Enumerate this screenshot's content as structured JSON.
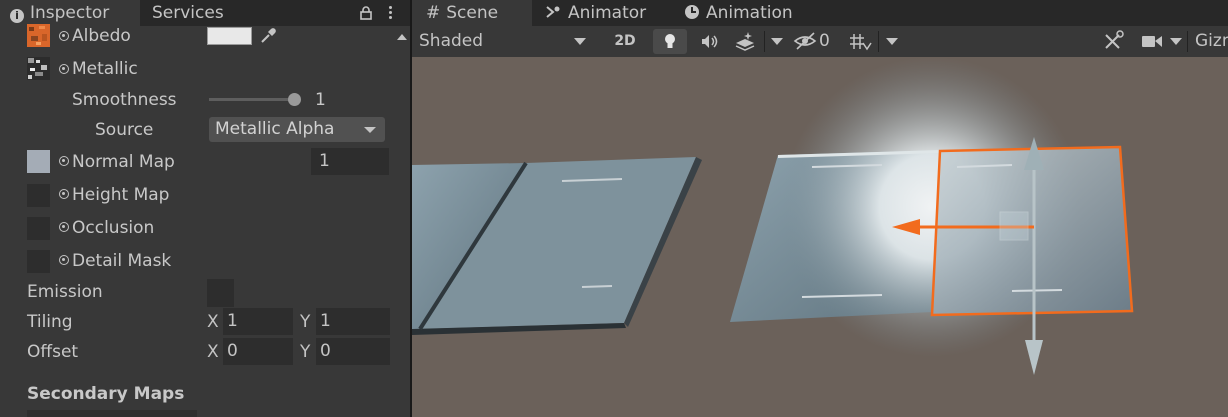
{
  "inspector": {
    "tabs": {
      "inspector": "Inspector",
      "services": "Services"
    },
    "properties": {
      "albedo": "Albedo",
      "metallic": "Metallic",
      "smoothness": "Smoothness",
      "smoothness_value": "1",
      "source": "Source",
      "source_value": "Metallic Alpha",
      "normal_map": "Normal Map",
      "normal_scale": "1",
      "height_map": "Height Map",
      "occlusion": "Occlusion",
      "detail_mask": "Detail Mask",
      "emission": "Emission",
      "tiling": "Tiling",
      "offset": "Offset",
      "x_axis": "X",
      "y_axis": "Y",
      "tiling_x": "1",
      "tiling_y": "1",
      "offset_x": "0",
      "offset_y": "0",
      "secondary_maps": "Secondary Maps"
    },
    "smoothness_level": 1.0
  },
  "scene": {
    "tabs": {
      "scene": "Scene",
      "animator": "Animator",
      "animation": "Animation"
    },
    "toolbar": {
      "shading_mode": "Shaded",
      "mode_2d": "2D",
      "hidden_count": "0",
      "gizmos": "Gizmos"
    }
  },
  "colors": {
    "panel_bg": "#383838",
    "tab_bg": "#282828",
    "field_bg": "#2d2d2d",
    "viewport_bg": "#6b615a",
    "selection_outline": "#f26b1d"
  },
  "icons": [
    "info-icon",
    "lock-icon",
    "kebab-menu-icon",
    "hash-icon",
    "animator-icon",
    "clock-icon",
    "eyedropper-icon",
    "lightbulb-icon",
    "audio-icon",
    "effects-icon",
    "hidden-objects-icon",
    "grid-icon",
    "tools-icon",
    "camera-icon"
  ]
}
